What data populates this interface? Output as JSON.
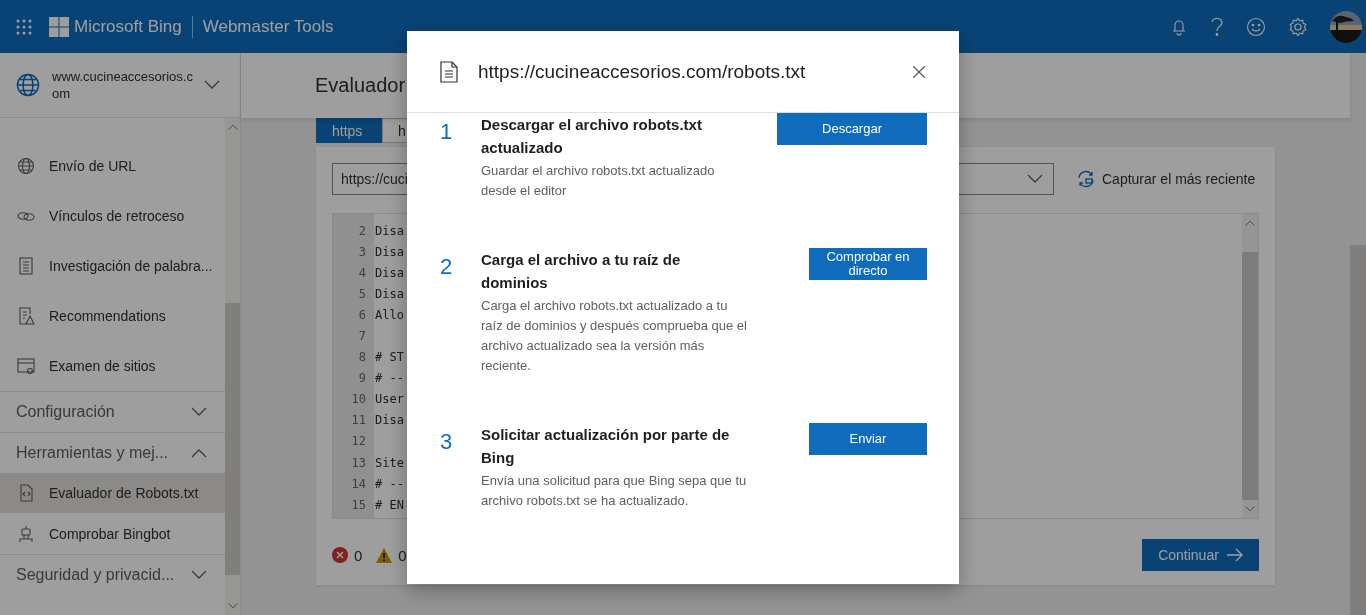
{
  "header": {
    "brand": "Microsoft Bing",
    "product": "Webmaster Tools"
  },
  "sidebar": {
    "site": "www.cucineaccesorios.com",
    "items": [
      {
        "kind": "link",
        "label": "Envío de URL",
        "selected": false
      },
      {
        "kind": "link",
        "label": "Vínculos de retroceso",
        "selected": false
      },
      {
        "kind": "link",
        "label": "Investigación de palabra...",
        "selected": false
      },
      {
        "kind": "link",
        "label": "Recommendations",
        "selected": false
      },
      {
        "kind": "link",
        "label": "Examen de sitios",
        "selected": false
      },
      {
        "kind": "group",
        "label": "Configuración",
        "expanded": false
      },
      {
        "kind": "group",
        "label": "Herramientas y mej...",
        "expanded": true
      },
      {
        "kind": "link",
        "label": "Evaluador de Robots.txt",
        "selected": true
      },
      {
        "kind": "link",
        "label": "Comprobar Bingbot",
        "selected": false
      },
      {
        "kind": "group",
        "label": "Seguridad y privacid...",
        "expanded": false
      }
    ]
  },
  "page": {
    "title": "Evaluador",
    "tabs": [
      {
        "label": "https",
        "selected": true
      },
      {
        "label": "h",
        "selected": false
      }
    ],
    "url_field": {
      "value": "https://cuci"
    },
    "capture_button": "Capturar el más reciente",
    "editor": {
      "lines": [
        {
          "number": "2",
          "text": "Disa"
        },
        {
          "number": "3",
          "text": "Disa"
        },
        {
          "number": "4",
          "text": "Disa"
        },
        {
          "number": "5",
          "text": "Disa"
        },
        {
          "number": "6",
          "text": "Allo"
        },
        {
          "number": "7"
        },
        {
          "number": "8",
          "text": "# ST"
        },
        {
          "number": "9",
          "text": "# --"
        },
        {
          "number": "10",
          "text": "User"
        },
        {
          "number": "11",
          "text": "Disa"
        },
        {
          "number": "12"
        },
        {
          "number": "13",
          "text": "Site"
        },
        {
          "number": "14",
          "text": "# --"
        },
        {
          "number": "15",
          "text": "# EN"
        }
      ]
    },
    "errors": "0",
    "warnings": "0",
    "continue_button": "Continuar"
  },
  "modal": {
    "title": "https://cucineaccesorios.com/robots.txt",
    "steps": [
      {
        "number": "1",
        "title": "Descargar el archivo robots.txt actualizado",
        "description": "Guardar el archivo robots.txt actualizado desde el editor",
        "button": "Descargar"
      },
      {
        "number": "2",
        "title": "Carga el archivo a tu raíz de dominios",
        "description": "Carga el archivo robots.txt actualizado a tu raíz de dominios y después comprueba que el archivo actualizado sea la versión más reciente.",
        "button": "Comprobar en directo"
      },
      {
        "number": "3",
        "title": "Solicitar actualización por parte de Bing",
        "description": "Envía una solicitud para que Bing sepa que tu archivo robots.txt se ha actualizado.",
        "button": "Enviar"
      }
    ]
  }
}
